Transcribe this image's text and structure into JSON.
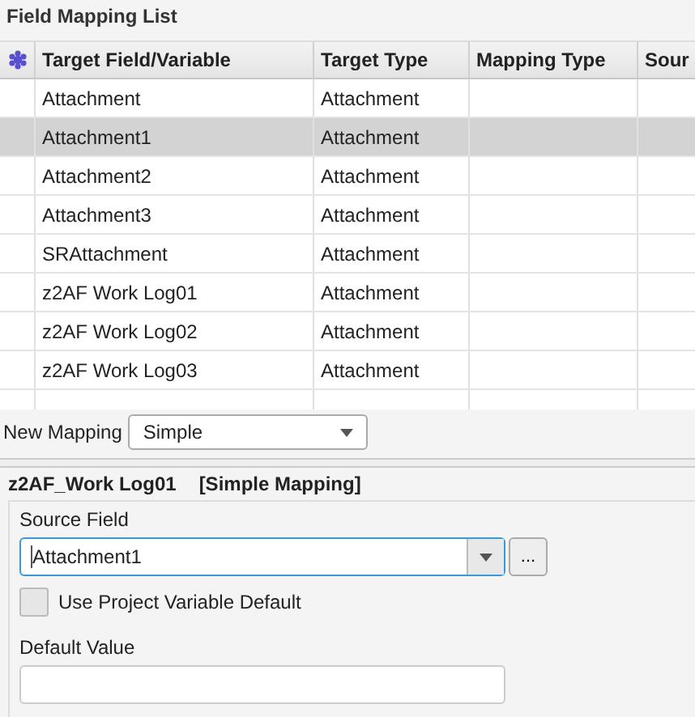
{
  "list_title": "Field Mapping List",
  "table": {
    "columns": [
      "Target Field/Variable",
      "Target Type",
      "Mapping Type",
      "Sour"
    ],
    "rows": [
      {
        "cells": [
          "Attachment",
          "Attachment"
        ],
        "selected": false
      },
      {
        "cells": [
          "Attachment1",
          "Attachment"
        ],
        "selected": true
      },
      {
        "cells": [
          "Attachment2",
          "Attachment"
        ],
        "selected": false
      },
      {
        "cells": [
          "Attachment3",
          "Attachment"
        ],
        "selected": false
      },
      {
        "cells": [
          "SRAttachment",
          "Attachment"
        ],
        "selected": false
      },
      {
        "cells": [
          "z2AF Work Log01",
          "Attachment"
        ],
        "selected": false
      },
      {
        "cells": [
          "z2AF Work Log02",
          "Attachment"
        ],
        "selected": false
      },
      {
        "cells": [
          "z2AF Work Log03",
          "Attachment"
        ],
        "selected": false
      }
    ]
  },
  "new_mapping": {
    "label": "New Mapping",
    "value": "Simple"
  },
  "detail": {
    "title": "z2AF_Work Log01",
    "mapping_kind": "[Simple Mapping]",
    "source_field": {
      "label": "Source Field",
      "value": "Attachment1",
      "browse": "..."
    },
    "use_default": {
      "label": "Use Project Variable Default",
      "checked": false
    },
    "default_value": {
      "label": "Default Value"
    }
  }
}
